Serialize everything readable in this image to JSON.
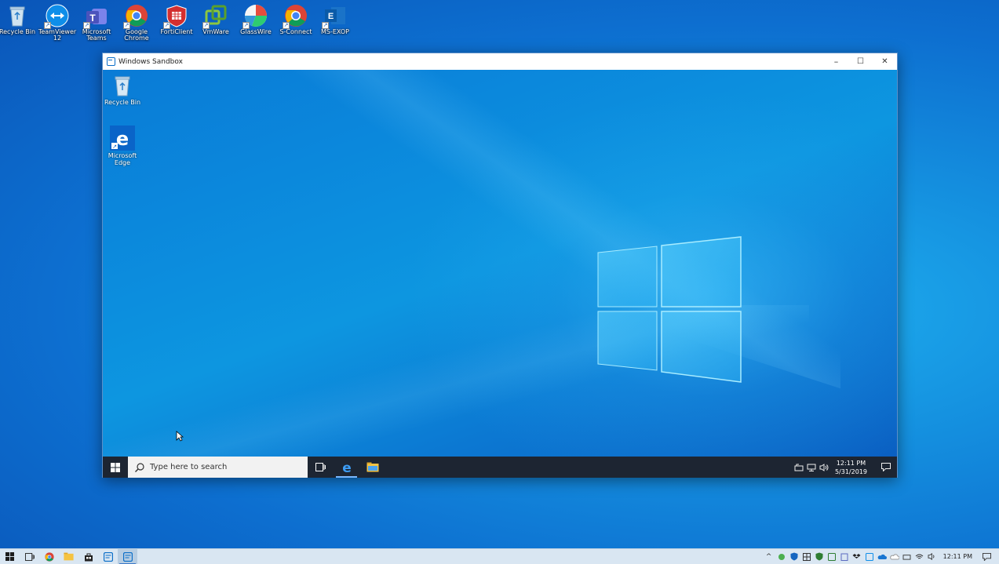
{
  "host_desktop": {
    "icons": [
      {
        "label": "Recycle Bin",
        "icon": "recycle-bin-icon"
      },
      {
        "label": "TeamViewer\n12",
        "icon": "teamviewer-icon"
      },
      {
        "label": "Microsoft\nTeams",
        "icon": "teams-icon"
      },
      {
        "label": "Google\nChrome",
        "icon": "chrome-icon"
      },
      {
        "label": "FortiClient",
        "icon": "forticlient-icon"
      },
      {
        "label": "VmWare",
        "icon": "vmware-icon"
      },
      {
        "label": "GlassWire",
        "icon": "glasswire-icon"
      },
      {
        "label": "S-Connect",
        "icon": "chrome-icon"
      },
      {
        "label": "MS-EXOP",
        "icon": "exchange-icon"
      }
    ]
  },
  "sandbox_window": {
    "title": "Windows Sandbox",
    "controls": {
      "minimize": "–",
      "maximize": "☐",
      "close": "✕"
    },
    "desktop_icons": [
      {
        "label": "Recycle Bin",
        "icon": "recycle-bin-icon"
      },
      {
        "label": "Microsoft\nEdge",
        "icon": "edge-icon"
      }
    ],
    "taskbar": {
      "search_placeholder": "Type here to search",
      "clock_time": "12:11 PM",
      "clock_date": "5/31/2019"
    }
  },
  "host_taskbar": {
    "clock_time": "12:11 PM"
  },
  "colors": {
    "accent": "#0078d7",
    "sandbox_taskbar": "#1d2532",
    "host_taskbar": "#d9e6f2"
  }
}
